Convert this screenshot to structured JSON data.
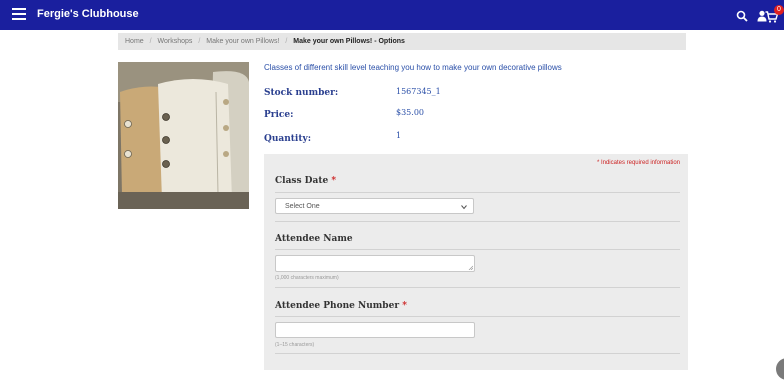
{
  "header": {
    "site_title": "Fergie's Clubhouse",
    "menu_icon": "hamburger-icon",
    "icons": [
      "search-icon",
      "user-icon",
      "cart-icon"
    ],
    "cart_count": "0",
    "bar_color": "#1a1f9e"
  },
  "breadcrumb": {
    "items": [
      "Home",
      "Workshops",
      "Make your own Pillows!"
    ],
    "current": "Make your own Pillows! - Options"
  },
  "product": {
    "description": "Classes of different skill level teaching you how to make your own decorative pillows",
    "stock_label": "Stock number:",
    "stock_value": "1567345_1",
    "price_label": "Price:",
    "price_value": "$35.00",
    "quantity_label": "Quantity:",
    "quantity_value": "1"
  },
  "form": {
    "required_note": "* Indicates required information",
    "class_date": {
      "label": "Class Date",
      "required": "*",
      "selected": "Select One"
    },
    "attendee_name": {
      "label": "Attendee Name",
      "hint": "(1,000 characters maximum)"
    },
    "attendee_phone": {
      "label": "Attendee Phone Number",
      "required": "*",
      "hint": "(1–15 characters)"
    }
  }
}
